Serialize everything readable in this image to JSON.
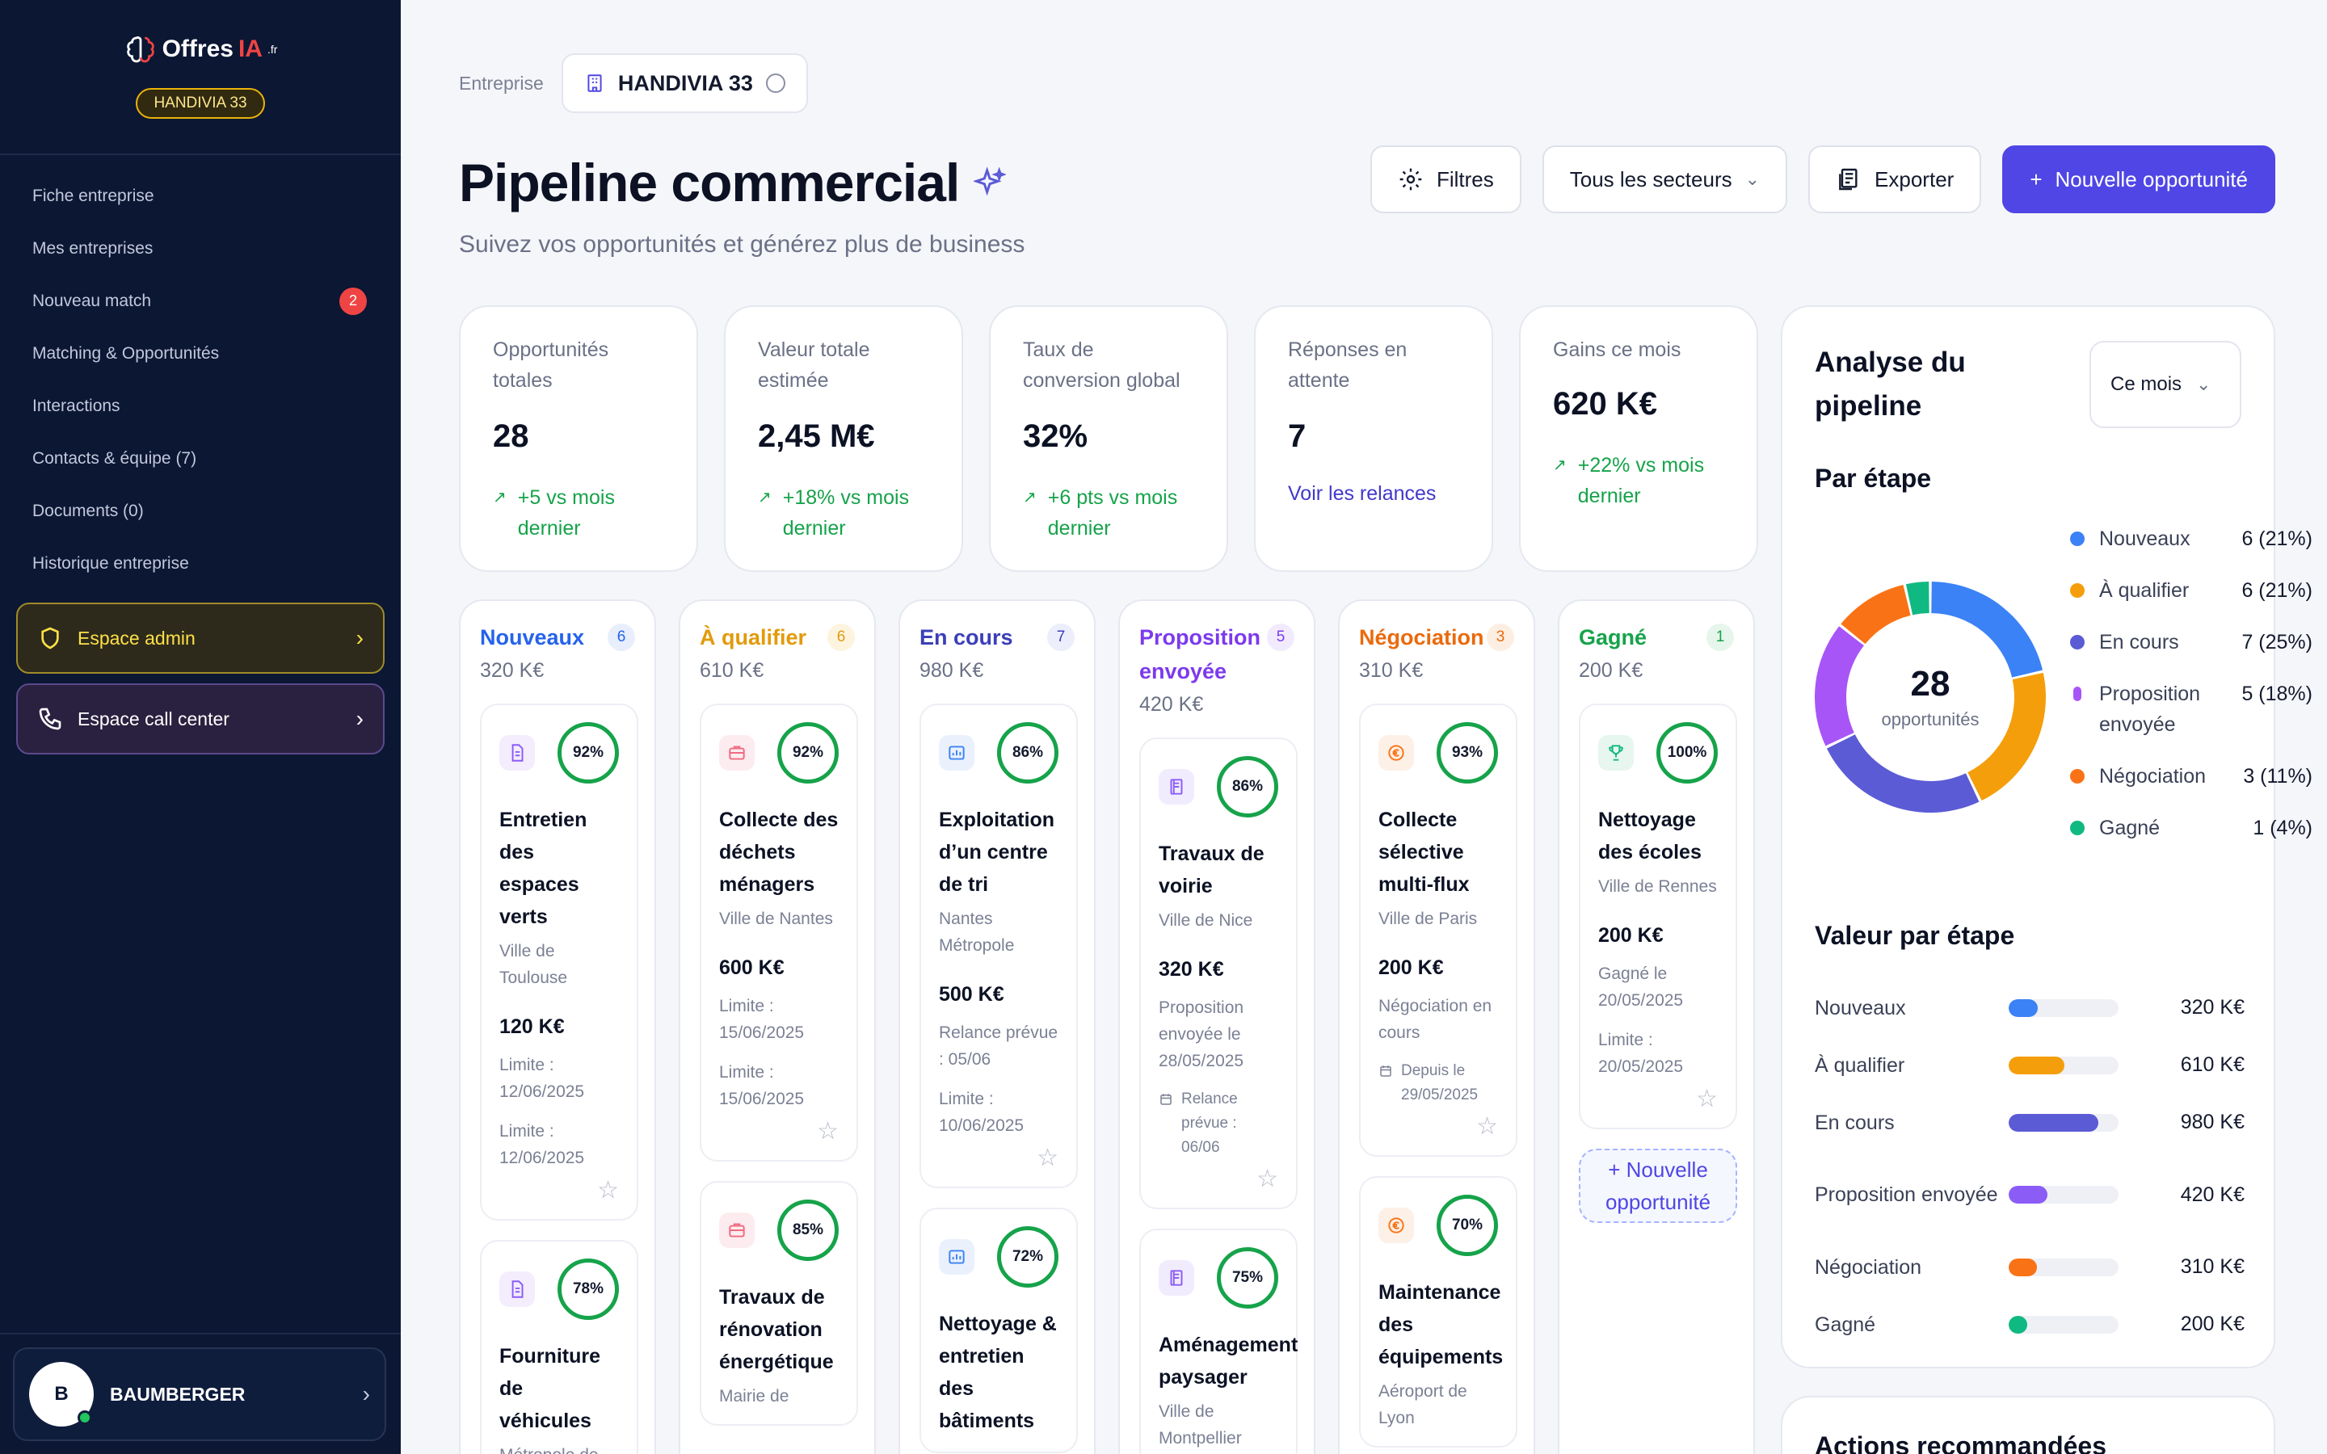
{
  "sidebar": {
    "brand": {
      "name_prefix": "Offres",
      "name_accent": "IA",
      "suffix": ".fr"
    },
    "company_badge": "HANDIVIA 33",
    "items": [
      {
        "label": "Fiche entreprise"
      },
      {
        "label": "Mes entreprises"
      },
      {
        "label": "Nouveau match",
        "badge": "2"
      },
      {
        "label": "Matching & Opportunités"
      },
      {
        "label": "Interactions"
      },
      {
        "label": "Contacts & équipe (7)"
      },
      {
        "label": "Documents (0)"
      },
      {
        "label": "Historique entreprise"
      }
    ],
    "admin_label": "Espace admin",
    "callcenter_label": "Espace call center",
    "user": {
      "initial": "B",
      "name": "BAUMBERGER"
    }
  },
  "header": {
    "crumb_label": "Entreprise",
    "company": "HANDIVIA 33",
    "title": "Pipeline commercial",
    "subtitle": "Suivez vos opportunités et générez plus de business",
    "filters_label": "Filtres",
    "sector_label": "Tous les secteurs",
    "export_label": "Exporter",
    "new_label": "Nouvelle opportunité",
    "new_plus": "+"
  },
  "kpis": [
    {
      "label": "Opportunités totales",
      "value": "28",
      "trend": "+5 vs mois dernier"
    },
    {
      "label": "Valeur totale estimée",
      "value": "2,45 M€",
      "trend": "+18% vs mois dernier"
    },
    {
      "label": "Taux de conversion global",
      "value": "32%",
      "trend": "+6 pts vs mois dernier"
    },
    {
      "label": "Réponses en attente",
      "value": "7",
      "link": "Voir les relances"
    },
    {
      "label": "Gains ce mois",
      "value": "620 K€",
      "trend": "+22% vs mois dernier"
    }
  ],
  "columns": [
    {
      "title": "Nouveaux",
      "count": "6",
      "value": "320 K€",
      "color": "#2563eb",
      "count_bg": "#e8eefc",
      "cards": [
        {
          "pct": "92%",
          "title": "Entretien des espaces verts",
          "client": "Ville de Toulouse",
          "amount": "120 K€",
          "meta1": "Limite : 12/06/2025",
          "meta2": "Limite : 12/06/2025"
        },
        {
          "pct": "78%",
          "title": "Fourniture de véhicules",
          "client": "Métropole de"
        }
      ]
    },
    {
      "title": "À qualifier",
      "count": "6",
      "value": "610 K€",
      "color": "#e29a0b",
      "count_bg": "#fdf4df",
      "cards": [
        {
          "pct": "92%",
          "title": "Collecte des déchets ménagers",
          "client": "Ville de Nantes",
          "amount": "600 K€",
          "meta1": "Limite : 15/06/2025",
          "meta2": "Limite : 15/06/2025"
        },
        {
          "pct": "85%",
          "title": "Travaux de rénovation énergétique",
          "client": "Mairie de"
        }
      ]
    },
    {
      "title": "En cours",
      "count": "7",
      "value": "980 K€",
      "color": "#3b3fb8",
      "count_bg": "#eceefc",
      "cards": [
        {
          "pct": "86%",
          "title": "Exploitation d’un centre de tri",
          "client": "Nantes Métropole",
          "amount": "500 K€",
          "meta1": "Relance prévue : 05/06",
          "meta2": "Limite : 10/06/2025"
        },
        {
          "pct": "72%",
          "title": "Nettoyage & entretien des bâtiments",
          "client": ""
        }
      ]
    },
    {
      "title": "Proposition envoyée",
      "count": "5",
      "value": "420 K€",
      "color": "#7c3aed",
      "count_bg": "#f1ebfd",
      "cards": [
        {
          "pct": "86%",
          "title": "Travaux de voirie",
          "client": "Ville de Nice",
          "amount": "320 K€",
          "meta1": "Proposition envoyée le 28/05/2025",
          "small": "Relance prévue : 06/06"
        },
        {
          "pct": "75%",
          "title": "Aménagement paysager",
          "client": "Ville de Montpellier"
        }
      ]
    },
    {
      "title": "Négociation",
      "count": "3",
      "value": "310 K€",
      "color": "#ea6a0c",
      "count_bg": "#fdeee2",
      "cards": [
        {
          "pct": "93%",
          "title": "Collecte sélective multi-flux",
          "client": "Ville de Paris",
          "amount": "200 K€",
          "meta1": "Négociation en cours",
          "small": "Depuis le 29/05/2025"
        },
        {
          "pct": "70%",
          "title": "Maintenance des équipements",
          "client": "Aéroport de Lyon"
        }
      ]
    },
    {
      "title": "Gagné",
      "count": "1",
      "value": "200 K€",
      "color": "#16a34a",
      "count_bg": "#e6f6ec",
      "cards": [
        {
          "pct": "100%",
          "title": "Nettoyage des écoles",
          "client": "Ville de Rennes",
          "amount": "200 K€",
          "meta1": "Gagné le 20/05/2025",
          "meta2": "Limite : 20/05/2025"
        }
      ],
      "add_label": "+ Nouvelle opportunité"
    }
  ],
  "panel": {
    "title": "Analyse du pipeline",
    "period": "Ce mois",
    "par_etape": "Par étape",
    "donut_total": "28",
    "donut_label": "opportunités",
    "valeur_title": "Valeur par étape",
    "next_title": "Actions recommandées"
  },
  "chart_data": [
    {
      "type": "pie",
      "title": "Par étape",
      "categories": [
        "Nouveaux",
        "À qualifier",
        "En cours",
        "Proposition envoyée",
        "Négociation",
        "Gagné"
      ],
      "values": [
        6,
        6,
        7,
        5,
        3,
        1
      ],
      "labels": [
        "6 (21%)",
        "6 (21%)",
        "7 (25%)",
        "5 (18%)",
        "3 (11%)",
        "1 (4%)"
      ],
      "colors": [
        "#3b82f6",
        "#f59e0b",
        "#5b5bd6",
        "#a855f7",
        "#f97316",
        "#10b981"
      ],
      "legend": "right"
    },
    {
      "type": "bar",
      "title": "Valeur par étape",
      "categories": [
        "Nouveaux",
        "À qualifier",
        "En cours",
        "Proposition envoyée",
        "Négociation",
        "Gagné"
      ],
      "values": [
        320,
        610,
        980,
        420,
        310,
        200
      ],
      "labels": [
        "320 K€",
        "610 K€",
        "980 K€",
        "420 K€",
        "310 K€",
        "200 K€"
      ],
      "unit": "K€",
      "colors": [
        "#3b82f6",
        "#f59e0b",
        "#5b5bd6",
        "#8b5cf6",
        "#f97316",
        "#10b981"
      ]
    }
  ]
}
